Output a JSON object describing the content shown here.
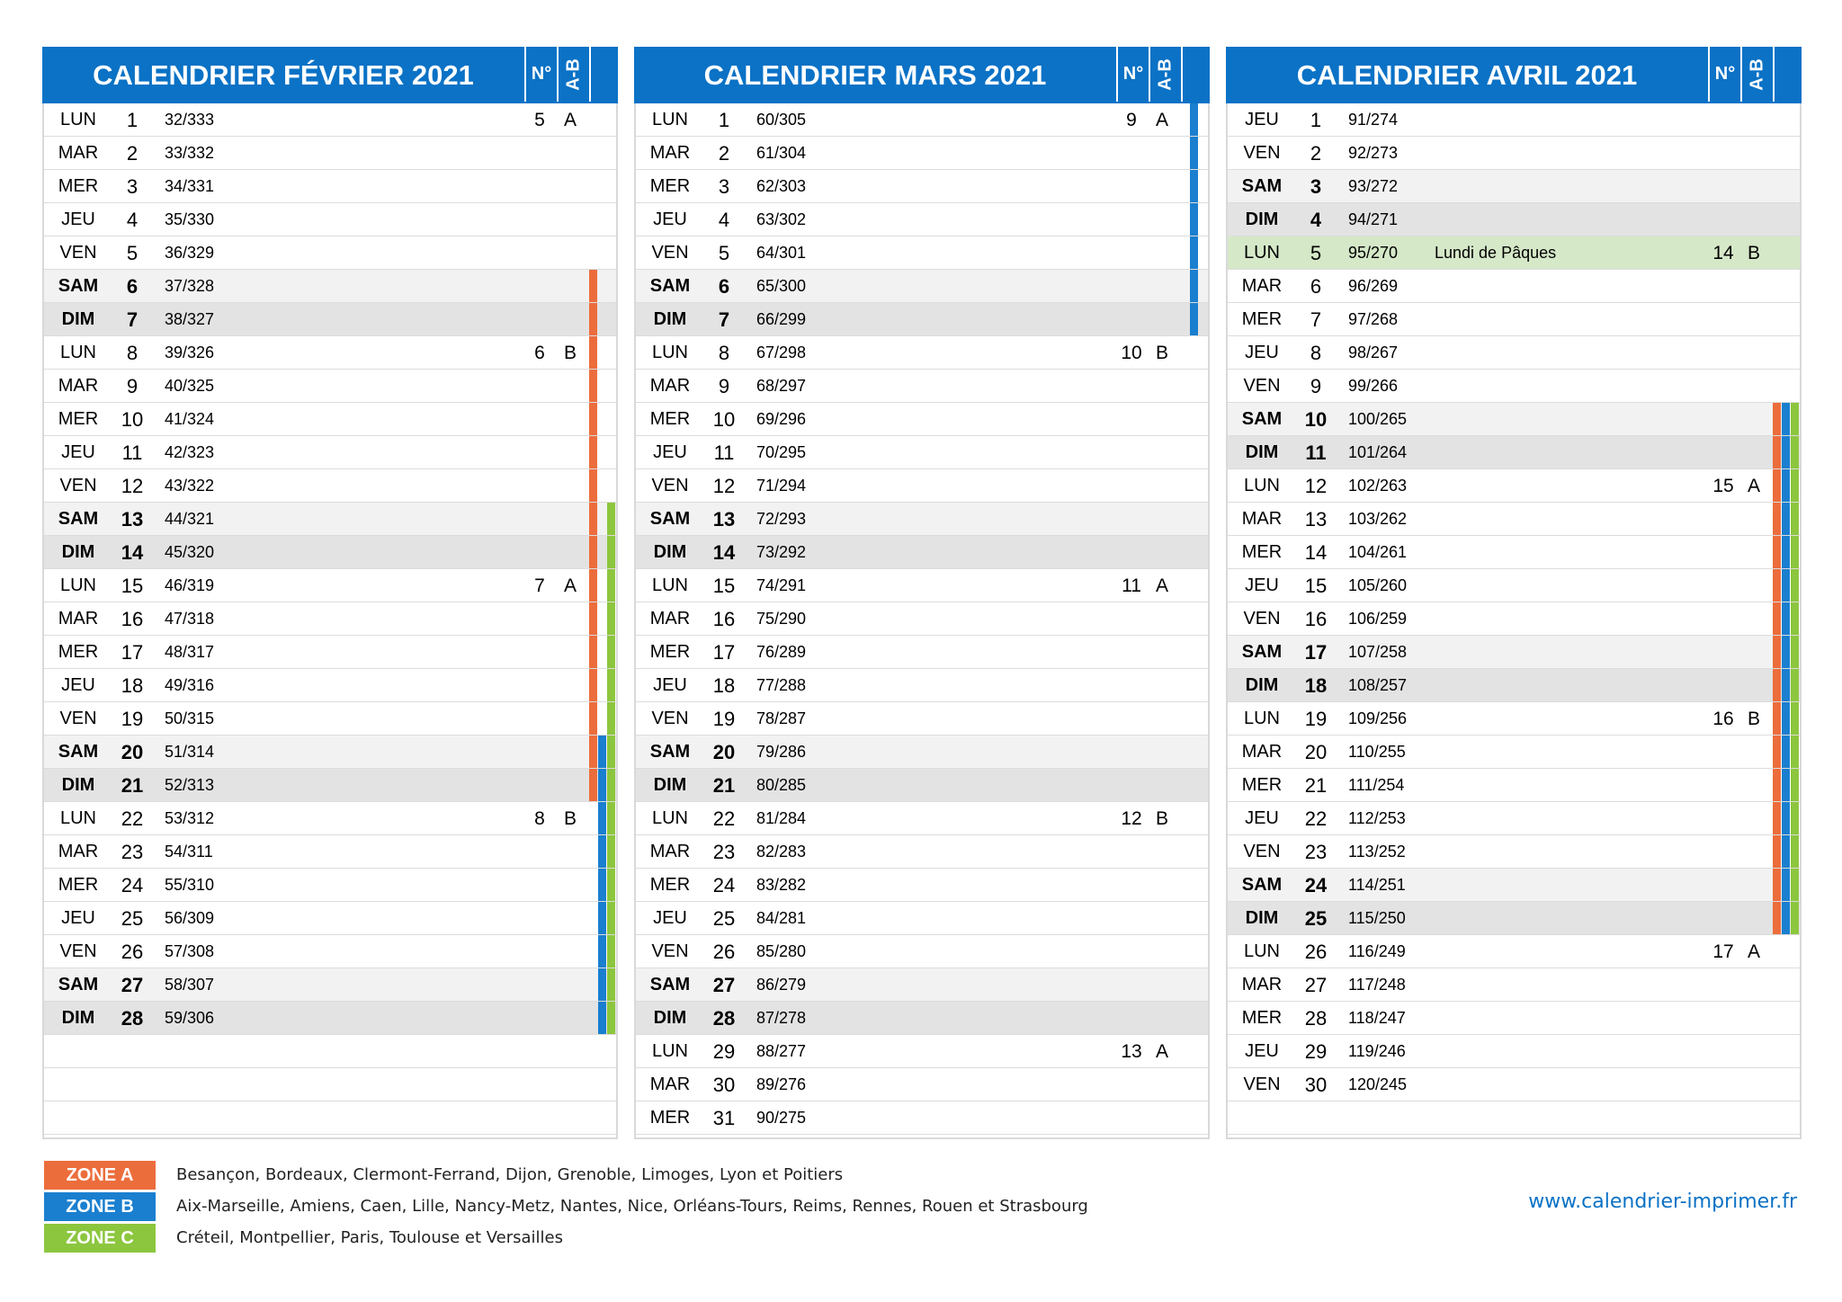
{
  "header_no_label": "N°",
  "header_ab_label": "A-B",
  "colors": {
    "header": "#0b72c6",
    "zone_a": "#ec6d3c",
    "zone_b": "#1a7fcf",
    "zone_c": "#8cc63e",
    "holiday": "#d5e8c8"
  },
  "months": [
    {
      "title": "CALENDRIER FÉVRIER 2021",
      "days": [
        {
          "dn": "LUN",
          "d": "1",
          "dy": "32/333",
          "wn": "5",
          "wl": "A"
        },
        {
          "dn": "MAR",
          "d": "2",
          "dy": "33/332"
        },
        {
          "dn": "MER",
          "d": "3",
          "dy": "34/331"
        },
        {
          "dn": "JEU",
          "d": "4",
          "dy": "35/330"
        },
        {
          "dn": "VEN",
          "d": "5",
          "dy": "36/329"
        },
        {
          "dn": "SAM",
          "d": "6",
          "dy": "37/328",
          "z": "A"
        },
        {
          "dn": "DIM",
          "d": "7",
          "dy": "38/327",
          "z": "A"
        },
        {
          "dn": "LUN",
          "d": "8",
          "dy": "39/326",
          "wn": "6",
          "wl": "B",
          "z": "A"
        },
        {
          "dn": "MAR",
          "d": "9",
          "dy": "40/325",
          "z": "A"
        },
        {
          "dn": "MER",
          "d": "10",
          "dy": "41/324",
          "z": "A"
        },
        {
          "dn": "JEU",
          "d": "11",
          "dy": "42/323",
          "z": "A"
        },
        {
          "dn": "VEN",
          "d": "12",
          "dy": "43/322",
          "z": "A"
        },
        {
          "dn": "SAM",
          "d": "13",
          "dy": "44/321",
          "z": "AC"
        },
        {
          "dn": "DIM",
          "d": "14",
          "dy": "45/320",
          "z": "AC"
        },
        {
          "dn": "LUN",
          "d": "15",
          "dy": "46/319",
          "wn": "7",
          "wl": "A",
          "z": "AC"
        },
        {
          "dn": "MAR",
          "d": "16",
          "dy": "47/318",
          "z": "AC"
        },
        {
          "dn": "MER",
          "d": "17",
          "dy": "48/317",
          "z": "AC"
        },
        {
          "dn": "JEU",
          "d": "18",
          "dy": "49/316",
          "z": "AC"
        },
        {
          "dn": "VEN",
          "d": "19",
          "dy": "50/315",
          "z": "AC"
        },
        {
          "dn": "SAM",
          "d": "20",
          "dy": "51/314",
          "z": "ABC"
        },
        {
          "dn": "DIM",
          "d": "21",
          "dy": "52/313",
          "z": "ABC"
        },
        {
          "dn": "LUN",
          "d": "22",
          "dy": "53/312",
          "wn": "8",
          "wl": "B",
          "z": "BC"
        },
        {
          "dn": "MAR",
          "d": "23",
          "dy": "54/311",
          "z": "BC"
        },
        {
          "dn": "MER",
          "d": "24",
          "dy": "55/310",
          "z": "BC"
        },
        {
          "dn": "JEU",
          "d": "25",
          "dy": "56/309",
          "z": "BC"
        },
        {
          "dn": "VEN",
          "d": "26",
          "dy": "57/308",
          "z": "BC"
        },
        {
          "dn": "SAM",
          "d": "27",
          "dy": "58/307",
          "z": "BC"
        },
        {
          "dn": "DIM",
          "d": "28",
          "dy": "59/306",
          "z": "BC"
        }
      ]
    },
    {
      "title": "CALENDRIER MARS 2021",
      "days": [
        {
          "dn": "LUN",
          "d": "1",
          "dy": "60/305",
          "wn": "9",
          "wl": "A",
          "z": "B"
        },
        {
          "dn": "MAR",
          "d": "2",
          "dy": "61/304",
          "z": "B"
        },
        {
          "dn": "MER",
          "d": "3",
          "dy": "62/303",
          "z": "B"
        },
        {
          "dn": "JEU",
          "d": "4",
          "dy": "63/302",
          "z": "B"
        },
        {
          "dn": "VEN",
          "d": "5",
          "dy": "64/301",
          "z": "B"
        },
        {
          "dn": "SAM",
          "d": "6",
          "dy": "65/300",
          "z": "B"
        },
        {
          "dn": "DIM",
          "d": "7",
          "dy": "66/299",
          "z": "B"
        },
        {
          "dn": "LUN",
          "d": "8",
          "dy": "67/298",
          "wn": "10",
          "wl": "B"
        },
        {
          "dn": "MAR",
          "d": "9",
          "dy": "68/297"
        },
        {
          "dn": "MER",
          "d": "10",
          "dy": "69/296"
        },
        {
          "dn": "JEU",
          "d": "11",
          "dy": "70/295"
        },
        {
          "dn": "VEN",
          "d": "12",
          "dy": "71/294"
        },
        {
          "dn": "SAM",
          "d": "13",
          "dy": "72/293"
        },
        {
          "dn": "DIM",
          "d": "14",
          "dy": "73/292"
        },
        {
          "dn": "LUN",
          "d": "15",
          "dy": "74/291",
          "wn": "11",
          "wl": "A"
        },
        {
          "dn": "MAR",
          "d": "16",
          "dy": "75/290"
        },
        {
          "dn": "MER",
          "d": "17",
          "dy": "76/289"
        },
        {
          "dn": "JEU",
          "d": "18",
          "dy": "77/288"
        },
        {
          "dn": "VEN",
          "d": "19",
          "dy": "78/287"
        },
        {
          "dn": "SAM",
          "d": "20",
          "dy": "79/286"
        },
        {
          "dn": "DIM",
          "d": "21",
          "dy": "80/285"
        },
        {
          "dn": "LUN",
          "d": "22",
          "dy": "81/284",
          "wn": "12",
          "wl": "B"
        },
        {
          "dn": "MAR",
          "d": "23",
          "dy": "82/283"
        },
        {
          "dn": "MER",
          "d": "24",
          "dy": "83/282"
        },
        {
          "dn": "JEU",
          "d": "25",
          "dy": "84/281"
        },
        {
          "dn": "VEN",
          "d": "26",
          "dy": "85/280"
        },
        {
          "dn": "SAM",
          "d": "27",
          "dy": "86/279"
        },
        {
          "dn": "DIM",
          "d": "28",
          "dy": "87/278"
        },
        {
          "dn": "LUN",
          "d": "29",
          "dy": "88/277",
          "wn": "13",
          "wl": "A"
        },
        {
          "dn": "MAR",
          "d": "30",
          "dy": "89/276"
        },
        {
          "dn": "MER",
          "d": "31",
          "dy": "90/275"
        }
      ]
    },
    {
      "title": "CALENDRIER AVRIL 2021",
      "days": [
        {
          "dn": "JEU",
          "d": "1",
          "dy": "91/274"
        },
        {
          "dn": "VEN",
          "d": "2",
          "dy": "92/273"
        },
        {
          "dn": "SAM",
          "d": "3",
          "dy": "93/272"
        },
        {
          "dn": "DIM",
          "d": "4",
          "dy": "94/271"
        },
        {
          "dn": "LUN",
          "d": "5",
          "dy": "95/270",
          "h": "Lundi de Pâques",
          "wn": "14",
          "wl": "B"
        },
        {
          "dn": "MAR",
          "d": "6",
          "dy": "96/269"
        },
        {
          "dn": "MER",
          "d": "7",
          "dy": "97/268"
        },
        {
          "dn": "JEU",
          "d": "8",
          "dy": "98/267"
        },
        {
          "dn": "VEN",
          "d": "9",
          "dy": "99/266"
        },
        {
          "dn": "SAM",
          "d": "10",
          "dy": "100/265",
          "z": "ABC"
        },
        {
          "dn": "DIM",
          "d": "11",
          "dy": "101/264",
          "z": "ABC"
        },
        {
          "dn": "LUN",
          "d": "12",
          "dy": "102/263",
          "wn": "15",
          "wl": "A",
          "z": "ABC"
        },
        {
          "dn": "MAR",
          "d": "13",
          "dy": "103/262",
          "z": "ABC"
        },
        {
          "dn": "MER",
          "d": "14",
          "dy": "104/261",
          "z": "ABC"
        },
        {
          "dn": "JEU",
          "d": "15",
          "dy": "105/260",
          "z": "ABC"
        },
        {
          "dn": "VEN",
          "d": "16",
          "dy": "106/259",
          "z": "ABC"
        },
        {
          "dn": "SAM",
          "d": "17",
          "dy": "107/258",
          "z": "ABC"
        },
        {
          "dn": "DIM",
          "d": "18",
          "dy": "108/257",
          "z": "ABC"
        },
        {
          "dn": "LUN",
          "d": "19",
          "dy": "109/256",
          "wn": "16",
          "wl": "B",
          "z": "ABC"
        },
        {
          "dn": "MAR",
          "d": "20",
          "dy": "110/255",
          "z": "ABC"
        },
        {
          "dn": "MER",
          "d": "21",
          "dy": "111/254",
          "z": "ABC"
        },
        {
          "dn": "JEU",
          "d": "22",
          "dy": "112/253",
          "z": "ABC"
        },
        {
          "dn": "VEN",
          "d": "23",
          "dy": "113/252",
          "z": "ABC"
        },
        {
          "dn": "SAM",
          "d": "24",
          "dy": "114/251",
          "z": "ABC"
        },
        {
          "dn": "DIM",
          "d": "25",
          "dy": "115/250",
          "z": "ABC"
        },
        {
          "dn": "LUN",
          "d": "26",
          "dy": "116/249",
          "wn": "17",
          "wl": "A"
        },
        {
          "dn": "MAR",
          "d": "27",
          "dy": "117/248"
        },
        {
          "dn": "MER",
          "d": "28",
          "dy": "118/247"
        },
        {
          "dn": "JEU",
          "d": "29",
          "dy": "119/246"
        },
        {
          "dn": "VEN",
          "d": "30",
          "dy": "120/245"
        }
      ]
    }
  ],
  "legend": [
    {
      "label": "ZONE A",
      "text": "Besançon, Bordeaux, Clermont-Ferrand, Dijon, Grenoble, Limoges, Lyon et Poitiers"
    },
    {
      "label": "ZONE B",
      "text": "Aix-Marseille, Amiens, Caen, Lille, Nancy-Metz, Nantes, Nice, Orléans-Tours, Reims, Rennes, Rouen et Strasbourg"
    },
    {
      "label": "ZONE C",
      "text": "Créteil, Montpellier, Paris, Toulouse et Versailles"
    }
  ],
  "website": "www.calendrier-imprimer.fr"
}
